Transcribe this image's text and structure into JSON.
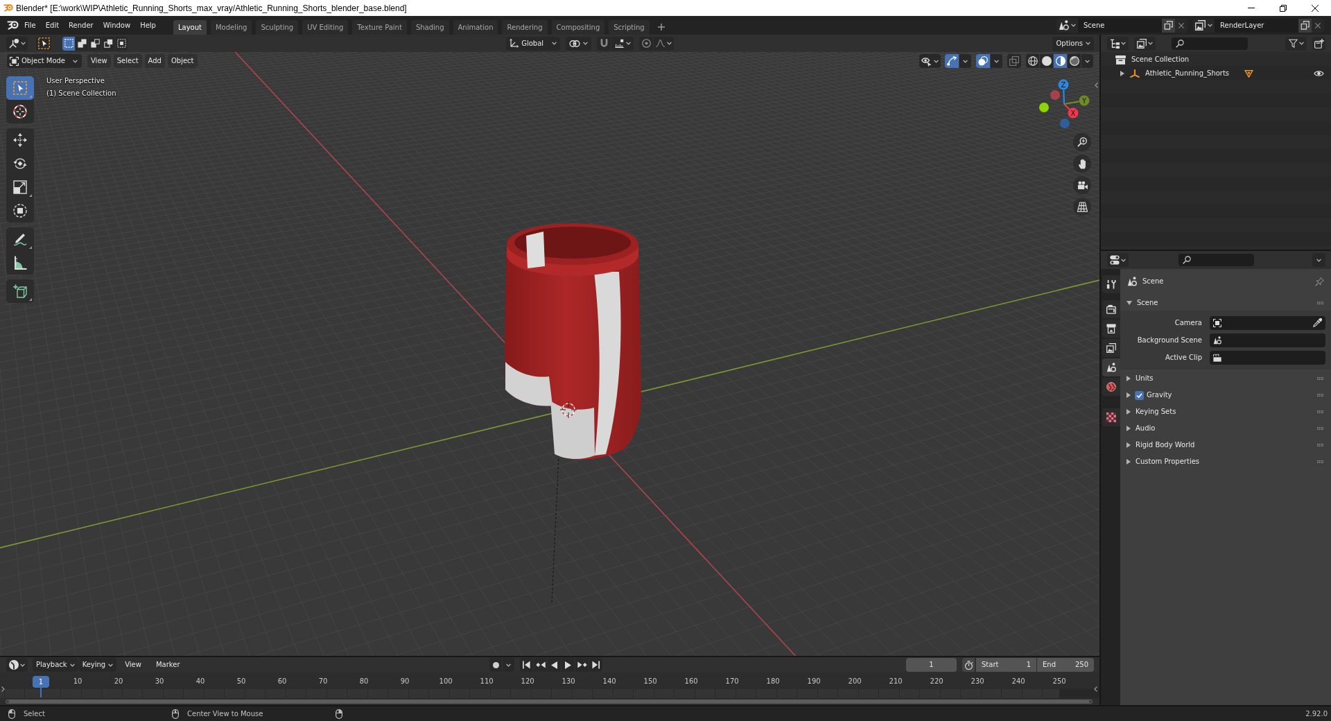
{
  "window": {
    "title": "Blender* [E:\\work\\WIP\\Athletic_Running_Shorts_max_vray/Athletic_Running_Shorts_blender_base.blend]"
  },
  "menu": [
    "File",
    "Edit",
    "Render",
    "Window",
    "Help"
  ],
  "workspaces": [
    {
      "label": "Layout",
      "selected": true
    },
    {
      "label": "Modeling",
      "selected": false
    },
    {
      "label": "Sculpting",
      "selected": false
    },
    {
      "label": "UV Editing",
      "selected": false
    },
    {
      "label": "Texture Paint",
      "selected": false
    },
    {
      "label": "Shading",
      "selected": false
    },
    {
      "label": "Animation",
      "selected": false
    },
    {
      "label": "Rendering",
      "selected": false
    },
    {
      "label": "Compositing",
      "selected": false
    },
    {
      "label": "Scripting",
      "selected": false
    }
  ],
  "scene": {
    "value": "Scene"
  },
  "view_layer": {
    "value": "RenderLayer"
  },
  "viewport": {
    "tool_header": {
      "select_modes": [
        {
          "kind": "set",
          "selected": true
        },
        {
          "kind": "extend",
          "selected": false
        },
        {
          "kind": "subtract",
          "selected": false
        },
        {
          "kind": "difference",
          "selected": false
        },
        {
          "kind": "intersect",
          "selected": false
        }
      ],
      "orientation": "Global",
      "snap": false,
      "proportional": false,
      "options": "Options"
    },
    "header": {
      "mode": "Object Mode",
      "menus": [
        "View",
        "Select",
        "Add",
        "Object"
      ],
      "toggles": [
        {
          "kind": "gizmos",
          "on": true
        },
        {
          "kind": "overlays",
          "on": true
        },
        {
          "kind": "xray",
          "on": false
        }
      ],
      "shading": [
        {
          "kind": "wireframe",
          "selected": false
        },
        {
          "kind": "solid",
          "selected": false
        },
        {
          "kind": "material",
          "selected": true
        },
        {
          "kind": "rendered",
          "selected": false
        }
      ]
    },
    "info": [
      "User Perspective",
      "(1) Scene Collection"
    ],
    "tool_groups": [
      {
        "tools": [
          {
            "kind": "select_box",
            "selected": true,
            "has_variants": true
          },
          {
            "kind": "cursor",
            "selected": false,
            "has_variants": false
          }
        ]
      },
      {
        "tools": [
          {
            "kind": "move",
            "selected": false,
            "has_variants": false
          },
          {
            "kind": "rotate",
            "selected": false,
            "has_variants": false
          },
          {
            "kind": "scale",
            "selected": false,
            "has_variants": true
          },
          {
            "kind": "transform",
            "selected": false,
            "has_variants": false
          }
        ]
      },
      {
        "tools": [
          {
            "kind": "annotate",
            "selected": false,
            "has_variants": true
          },
          {
            "kind": "measure",
            "selected": false,
            "has_variants": false
          }
        ]
      },
      {
        "tools": [
          {
            "kind": "add_cube",
            "selected": false,
            "has_variants": true
          }
        ]
      }
    ],
    "gizmo_axes": [
      {
        "label": "X",
        "color": "#f0374f"
      },
      {
        "label": "Y",
        "color": "#6f8b24"
      },
      {
        "label": "Z",
        "color": "#2d87e0"
      }
    ],
    "gizmo_negative_axes": [
      {
        "color": "#a6414e"
      },
      {
        "color": "#8bd600"
      },
      {
        "color": "#2f5f98"
      }
    ]
  },
  "outliner": {
    "root": "Scene Collection",
    "items": [
      {
        "label": "Athletic_Running_Shorts",
        "expanded": false,
        "visible": true
      }
    ]
  },
  "properties": {
    "tab_groups": [
      {
        "tabs": [
          {
            "kind": "tool",
            "selected": false
          }
        ]
      },
      {
        "tabs": [
          {
            "kind": "render",
            "selected": false
          },
          {
            "kind": "output",
            "selected": false
          },
          {
            "kind": "view_layer",
            "selected": false
          },
          {
            "kind": "scene",
            "selected": true
          },
          {
            "kind": "world",
            "selected": false
          }
        ]
      },
      {
        "tabs": [
          {
            "kind": "texture",
            "selected": false
          }
        ]
      }
    ],
    "context": "Scene",
    "panels": [
      {
        "title": "Scene",
        "expanded": true,
        "fields": [
          {
            "label": "Camera",
            "kind": "object"
          },
          {
            "label": "Background Scene",
            "kind": "scene"
          },
          {
            "label": "Active Clip",
            "kind": "clip"
          }
        ]
      },
      {
        "title": "Units",
        "expanded": false
      },
      {
        "title": "Gravity",
        "expanded": false,
        "checkbox": {
          "checked": true
        }
      },
      {
        "title": "Keying Sets",
        "expanded": false
      },
      {
        "title": "Audio",
        "expanded": false
      },
      {
        "title": "Rigid Body World",
        "expanded": false
      },
      {
        "title": "Custom Properties",
        "expanded": false
      }
    ]
  },
  "timeline": {
    "menus": [
      {
        "label": "Playback",
        "kind": "dropdown"
      },
      {
        "label": "Keying",
        "kind": "dropdown"
      },
      {
        "label": "View",
        "kind": "menu"
      },
      {
        "label": "Marker",
        "kind": "menu"
      }
    ],
    "auto_keying": false,
    "current_frame": "1",
    "start": {
      "label": "Start",
      "value": "1"
    },
    "end": {
      "label": "End",
      "value": "250"
    },
    "playhead": "1",
    "ruler": [
      "10",
      "20",
      "30",
      "40",
      "50",
      "60",
      "70",
      "80",
      "90",
      "100",
      "110",
      "120",
      "130",
      "140",
      "150",
      "160",
      "170",
      "180",
      "190",
      "200",
      "210",
      "220",
      "230",
      "240",
      "250"
    ]
  },
  "status_bar": {
    "hints": [
      {
        "kind": "left_mouse",
        "label": "Select"
      },
      {
        "kind": "middle_mouse",
        "label": "Center View to Mouse"
      },
      {
        "kind": "right_mouse"
      }
    ],
    "version": "2.92.0"
  }
}
